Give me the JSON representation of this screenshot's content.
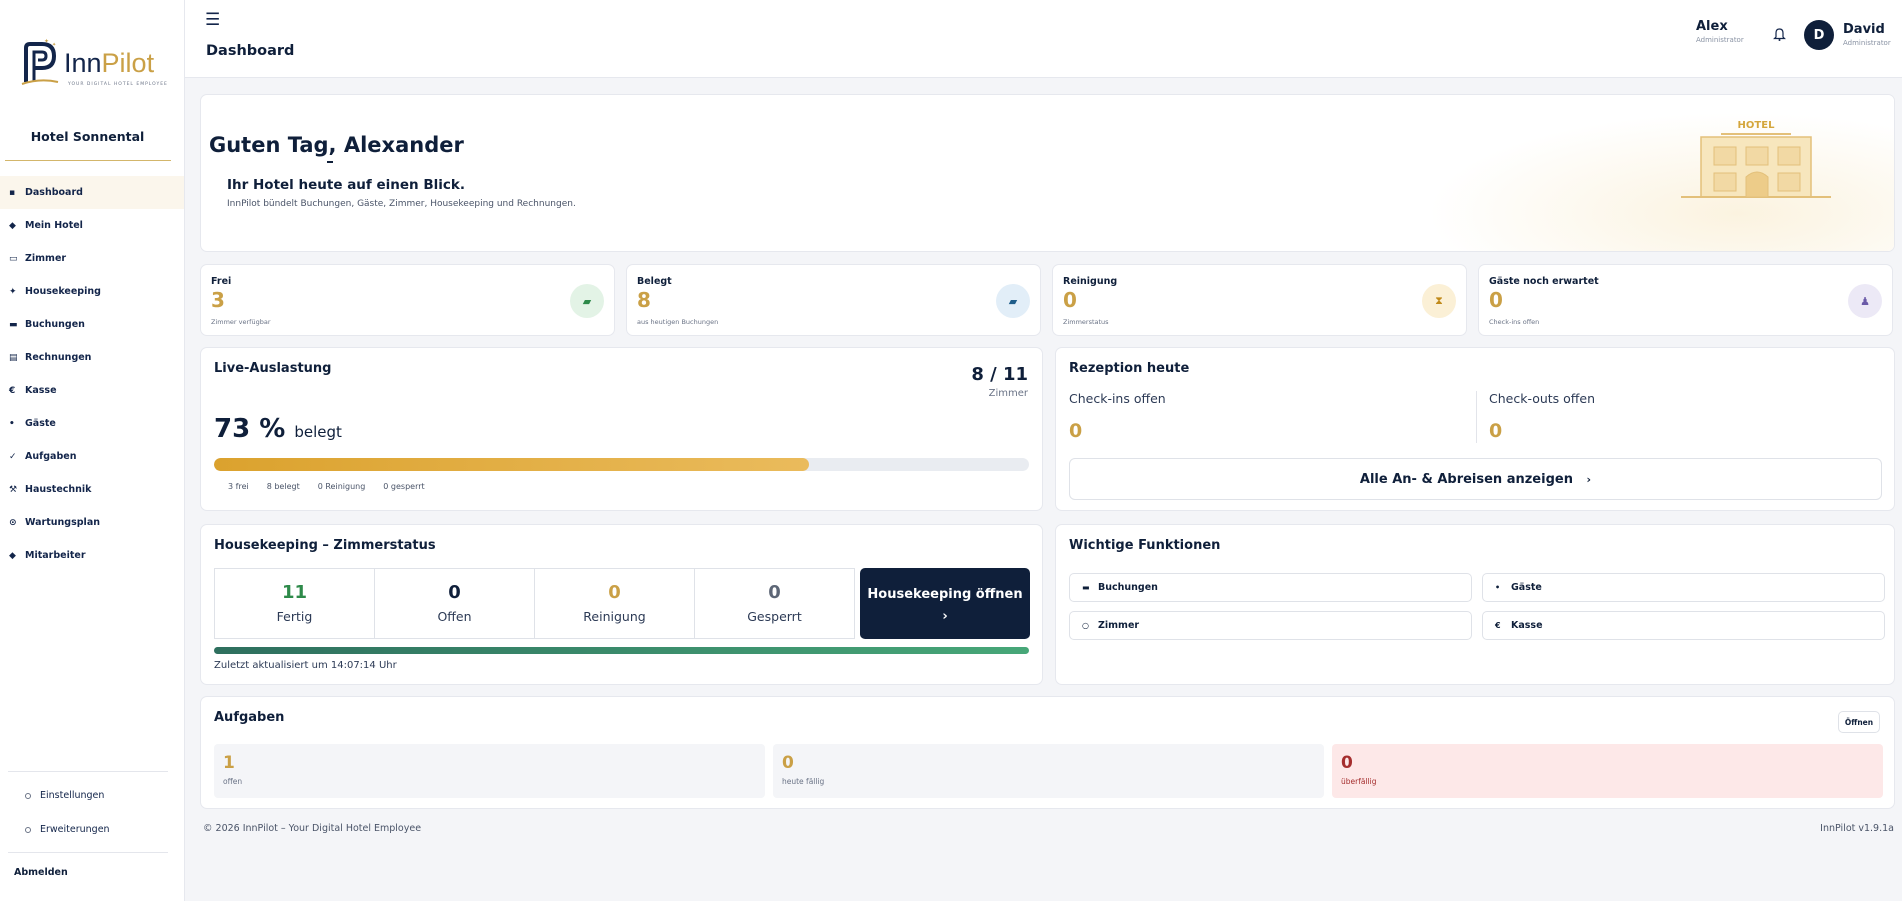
{
  "brand": {
    "name_a": "Inn",
    "name_b": "Pilot",
    "tagline": "YOUR DIGITAL HOTEL EMPLOYEE"
  },
  "sidebar": {
    "hotel_name": "Hotel Sonnental",
    "items": [
      {
        "label": "Dashboard",
        "icon": "▪"
      },
      {
        "label": "Mein Hotel",
        "icon": "◆"
      },
      {
        "label": "Zimmer",
        "icon": "▭"
      },
      {
        "label": "Housekeeping",
        "icon": "✦"
      },
      {
        "label": "Buchungen",
        "icon": "▬"
      },
      {
        "label": "Rechnungen",
        "icon": "▤"
      },
      {
        "label": "Kasse",
        "icon": "€"
      },
      {
        "label": "Gäste",
        "icon": "•"
      },
      {
        "label": "Aufgaben",
        "icon": "✓"
      },
      {
        "label": "Haustechnik",
        "icon": "⚒"
      },
      {
        "label": "Wartungsplan",
        "icon": "⊙"
      },
      {
        "label": "Mitarbeiter",
        "icon": "◆"
      }
    ],
    "settings": "Einstellungen",
    "extensions": "Erweiterungen",
    "logout": "Abmelden"
  },
  "topbar": {
    "title": "Dashboard",
    "user1": {
      "name": "Alex",
      "role": "Administrator"
    },
    "user2": {
      "initial": "D",
      "name": "David",
      "role": "Administrator"
    }
  },
  "greeting": {
    "title": "Guten Tag, Alexander",
    "subtitle": "Ihr Hotel heute auf einen Blick.",
    "text": "InnPilot bündelt Buchungen, Gäste, Zimmer, Housekeeping und Rechnungen.",
    "sign": "HOTEL"
  },
  "stats": [
    {
      "label": "Frei",
      "value": "3",
      "sub": "Zimmer verfügbar",
      "bg": "#e3f3e6",
      "fg": "#2e8a4a"
    },
    {
      "label": "Belegt",
      "value": "8",
      "sub": "aus heutigen Buchungen",
      "bg": "#e2eef8",
      "fg": "#1f5d8a"
    },
    {
      "label": "Reinigung",
      "value": "0",
      "sub": "Zimmerstatus",
      "bg": "#fbf0d6",
      "fg": "#c08a1a"
    },
    {
      "label": "Gäste noch erwartet",
      "value": "0",
      "sub": "Check-ins offen",
      "bg": "#ece9f6",
      "fg": "#6a5aa8"
    }
  ],
  "live": {
    "title": "Live-Auslastung",
    "ratio": "8 / 11",
    "ratio_sub": "Zimmer",
    "percent": "73 %",
    "percent_sub": "belegt",
    "fill": 0.73,
    "legend": [
      "3 frei",
      "8 belegt",
      "0 Reinigung",
      "0 gesperrt"
    ]
  },
  "reception": {
    "title": "Rezeption heute",
    "checkins_label": "Check-ins offen",
    "checkins": "0",
    "checkouts_label": "Check-outs offen",
    "checkouts": "0",
    "button": "Alle An- & Abreisen anzeigen",
    "button_arrow": "›"
  },
  "housekeeping": {
    "title": "Housekeeping – Zimmerstatus",
    "cells": [
      {
        "value": "11",
        "label": "Fertig",
        "color": "#2e8a4a"
      },
      {
        "value": "0",
        "label": "Offen",
        "color": "#0f1f3a"
      },
      {
        "value": "0",
        "label": "Reinigung",
        "color": "#caa046"
      },
      {
        "value": "0",
        "label": "Gesperrt",
        "color": "#5d6676"
      }
    ],
    "open_label": "Housekeeping öffnen",
    "open_arrow": "›",
    "updated": "Zuletzt aktualisiert um 14:07:14 Uhr"
  },
  "functions": {
    "title": "Wichtige Funktionen",
    "items": [
      {
        "label": "Buchungen",
        "icon": "▬"
      },
      {
        "label": "Gäste",
        "icon": "•"
      },
      {
        "label": "Zimmer",
        "icon": "○"
      },
      {
        "label": "Kasse",
        "icon": "€"
      }
    ]
  },
  "tasks": {
    "title": "Aufgaben",
    "open_button": "Öffnen",
    "boxes": [
      {
        "value": "1",
        "label": "offen"
      },
      {
        "value": "0",
        "label": "heute fällig"
      },
      {
        "value": "0",
        "label": "überfällig"
      }
    ]
  },
  "footer": {
    "left": "© 2026 InnPilot – Your Digital Hotel Employee",
    "right": "InnPilot v1.9.1a"
  }
}
